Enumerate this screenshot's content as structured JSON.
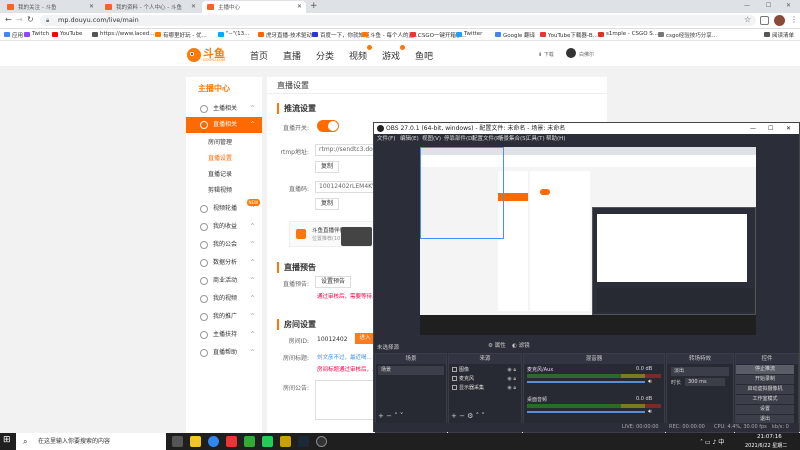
{
  "browser": {
    "tabs": [
      "我的关注 - 斗鱼",
      "我的资料 - 个人中心 - 斗鱼",
      "主播中心"
    ],
    "new_tab": "+",
    "url": "mp.douyu.com/live/main",
    "bookmarks": [
      "应用",
      "Twitch",
      "YouTube",
      "https://www.laced...",
      "有哪里好玩 - 优...",
      "\"--\"(13...",
      "虎牙直播-技术驱动...",
      "百度一下，你就知道",
      "斗鱼 - 每个人的直...",
      "CSGO一键开箱参...",
      "Twitter",
      "Google 翻译",
      "YouTube下载器-B...",
      "s1mple - CSGO S...",
      "csgo经验技巧分享...",
      "阅读清单"
    ]
  },
  "site": {
    "logo": "斗鱼",
    "logo_sub": "DOUYU.COM",
    "nav": [
      "首页",
      "直播",
      "分类",
      "视频",
      "游戏",
      "鱼吧"
    ],
    "user_links": [
      "下载",
      "白佛尔"
    ]
  },
  "sidebar": {
    "title": "主播中心",
    "items": [
      {
        "label": "主播相关",
        "arrow": "^"
      },
      {
        "label": "直播相关",
        "arrow": "^"
      },
      {
        "label": "房间管理"
      },
      {
        "label": "直播设置"
      },
      {
        "label": "直播记录"
      },
      {
        "label": "剪辑视频"
      },
      {
        "label": "视频轮播",
        "arrow": "^",
        "badge": "NEW"
      },
      {
        "label": "我的收益",
        "arrow": "^"
      },
      {
        "label": "我的公会",
        "arrow": "^"
      },
      {
        "label": "数据分析",
        "arrow": "^"
      },
      {
        "label": "商业活动",
        "arrow": "^"
      },
      {
        "label": "我的视频",
        "arrow": "^"
      },
      {
        "label": "我的推广",
        "arrow": "^"
      },
      {
        "label": "主播扶持",
        "arrow": "^"
      },
      {
        "label": "直播帮助",
        "arrow": "^"
      }
    ]
  },
  "main": {
    "title": "直播设置",
    "stream": {
      "heading": "推流设置",
      "switch_label": "直播开关:",
      "rtmp_label": "rtmp地址:",
      "rtmp_value": "rtmp://sendtc3.douyu...",
      "copy1": "复制",
      "key_label": "直播码:",
      "key_value": "10012402rLEM4KV...",
      "copy2": "复制",
      "tool_title": "斗鱼直播伴侣",
      "tool_sub": "位置推荐(10)帮..."
    },
    "preview": {
      "heading": "直播预告",
      "label": "直播预告:",
      "button": "设置预告",
      "note": "通过审核后，需要等待..."
    },
    "room": {
      "heading": "房间设置",
      "id_label": "房间ID:",
      "id_value": "10012402",
      "id_btn": "进入",
      "title_label": "房间标题:",
      "title_value": "刘文彦不过，最近喝...",
      "title_note": "房间标题通过审核后，...",
      "notice_label": "房间公告:"
    }
  },
  "obs": {
    "title": "OBS 27.0.1 (64-bit, windows) - 配置文件: 未命名 - 场景: 未命名",
    "menu": [
      "文件(F)",
      "编辑(E)",
      "视图(V)",
      "停靠部件(D)",
      "配置文件(P)",
      "场景集合(S)",
      "工具(T)",
      "帮助(H)"
    ],
    "no_source": "未选择源",
    "props_btn": "属性",
    "filters_btn": "滤镜",
    "docks": {
      "scenes": "场景",
      "sources": "来源",
      "mixer": "混音器",
      "transitions": "转场特效",
      "controls": "控件"
    },
    "scene_item": "场景",
    "source_items": [
      "图像",
      "麦克风",
      "显示器采集"
    ],
    "mixer_tracks": [
      {
        "name": "麦克风/Aux",
        "db": "0.0 dB"
      },
      {
        "name": "桌面音频",
        "db": "0.0 dB"
      }
    ],
    "transition": "淡出",
    "duration_label": "时长",
    "duration": "300 ms",
    "controls": [
      "停止推流",
      "开始录制",
      "启动虚拟摄像机",
      "工作室模式",
      "设置",
      "退出"
    ],
    "status": {
      "live": "LIVE: 00:00:00",
      "rec": "REC: 00:00:00",
      "cpu": "CPU: 4.4%, 30.00 fps",
      "kb": "kb/s: 0"
    }
  },
  "taskbar": {
    "search": "在这里输入你要搜索的内容",
    "time": "21:07:16",
    "date": "2021/6/22 星期二"
  }
}
